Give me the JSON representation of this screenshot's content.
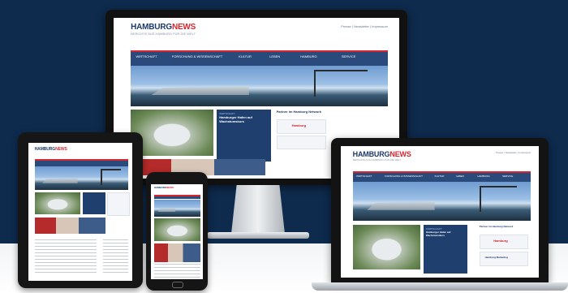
{
  "site": {
    "logo_main": "HAMBURG",
    "logo_accent": "NEWS",
    "tagline": "BERICHTE AUS HAMBURG FÜR DIE WELT",
    "nav": [
      "WIRTSCHAFT",
      "FORSCHUNG & WISSENSCHAFT",
      "KULTUR",
      "LEBEN",
      "HAMBURG",
      "SERVICE"
    ],
    "utility_links": "Presse | Newsletter | Impressum",
    "news_box": {
      "label": "WIRTSCHAFT",
      "headline": "Hamburger Hafen auf Wachstumskurs"
    },
    "side_title": "Partner im Hamburg Network",
    "side_ad_label": "Hamburg",
    "side_ad_label_2": "Hamburg Marketing"
  },
  "colors": {
    "background": "#0e2a4c",
    "brand_blue": "#1b3a6b",
    "brand_red": "#d8262e",
    "nav_blue": "#2a4a7c"
  }
}
